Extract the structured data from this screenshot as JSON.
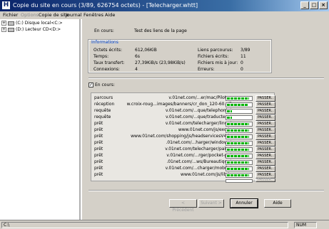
{
  "window": {
    "title": "Copie du site en cours (3/89, 626754 octets) - [Telecharger.whtt]",
    "app_icon": "H",
    "buttons": [
      "_",
      "□",
      "×"
    ]
  },
  "menu": {
    "items": [
      {
        "label": "Fichier",
        "disabled": false
      },
      {
        "label": "Options",
        "disabled": true
      },
      {
        "label": "Copie de site",
        "disabled": false
      },
      {
        "label": "Journal",
        "disabled": false
      },
      {
        "label": "Fenêtres",
        "disabled": false
      },
      {
        "label": "Aide",
        "disabled": false
      }
    ]
  },
  "tree": {
    "items": [
      {
        "expander": "+",
        "label": "(C:) Disque local<C:>",
        "icon": "hard-drive-icon"
      },
      {
        "expander": "+",
        "label": "(D:) Lecteur CD<D:>",
        "icon": "cd-drive-icon"
      }
    ]
  },
  "main": {
    "en_cours_label": "En cours:",
    "en_cours_value": "Test des liens de la page",
    "info_title": "Informations",
    "left_stats": [
      {
        "label": "Octets écrits:",
        "value": "612,06KiB"
      },
      {
        "label": "Temps:",
        "value": "6s"
      },
      {
        "label": "Taux transfert:",
        "value": "27,39KiB/s (23,98KiB/s)"
      },
      {
        "label": "Connexions:",
        "value": "4"
      }
    ],
    "right_stats": [
      {
        "label": "Liens parcourus:",
        "value": "3/89"
      },
      {
        "label": "Fichiers écrits:",
        "value": "11"
      },
      {
        "label": "Fichiers mis à jour:",
        "value": "0"
      },
      {
        "label": "Erreurs:",
        "value": "0"
      }
    ],
    "checkbox_label": "En cours:",
    "checkbox_mark": "✓",
    "pass_label": "PASSER..",
    "rows": [
      {
        "status": "parcours",
        "url": "v.01net.com/...er/mac/Pilotes",
        "progress": 0.9,
        "enabled": true
      },
      {
        "status": "réception",
        "url": "w.croix-roug...images/banners/cr_don_120-60.gif",
        "progress": 0.85,
        "enabled": true
      },
      {
        "status": "requête",
        "url": "v.01net.com/...que/telephonie/",
        "progress": 0.2,
        "enabled": true
      },
      {
        "status": "requête",
        "url": "v.01net.com/...que/traducteur/",
        "progress": 0.2,
        "enabled": true
      },
      {
        "status": "prêt",
        "url": "v.01net.com/telecharger/linux/",
        "progress": 0.9,
        "enabled": true
      },
      {
        "status": "prêt",
        "url": "www.01net.com/js/exc.js",
        "progress": 0.9,
        "enabled": true
      },
      {
        "status": "prêt",
        "url": "www.01net.com/shopping/js/headservicesV4.js",
        "progress": 0.9,
        "enabled": true
      },
      {
        "status": "prêt",
        "url": ".01net.com/...harger/windows/",
        "progress": 0.9,
        "enabled": true
      },
      {
        "status": "prêt",
        "url": "v.01net.com/telecharger/palm/",
        "progress": 0.9,
        "enabled": true
      },
      {
        "status": "prêt",
        "url": "v.01net.com/...rger/pocket-pc/",
        "progress": 0.9,
        "enabled": true
      },
      {
        "status": "prêt",
        "url": ".01net.com/...ws/Bureautique/",
        "progress": 0.9,
        "enabled": true
      },
      {
        "status": "prêt",
        "url": "v.01net.com/...charger/mobile/",
        "progress": 0.9,
        "enabled": true
      },
      {
        "status": "prêt",
        "url": "www.01net.com/js/lib.js",
        "progress": 0.9,
        "enabled": true
      },
      {
        "status": "",
        "url": "",
        "progress": 0,
        "enabled": false
      }
    ]
  },
  "buttons": {
    "precedent": "< Précédent",
    "suivant": "Suivant >",
    "annuler": "Annuler",
    "aide": "Aide"
  },
  "status": {
    "path": "C:\\",
    "num": "NUM"
  },
  "colors": {
    "progress": "#00b300",
    "info_title": "#0046d5"
  }
}
